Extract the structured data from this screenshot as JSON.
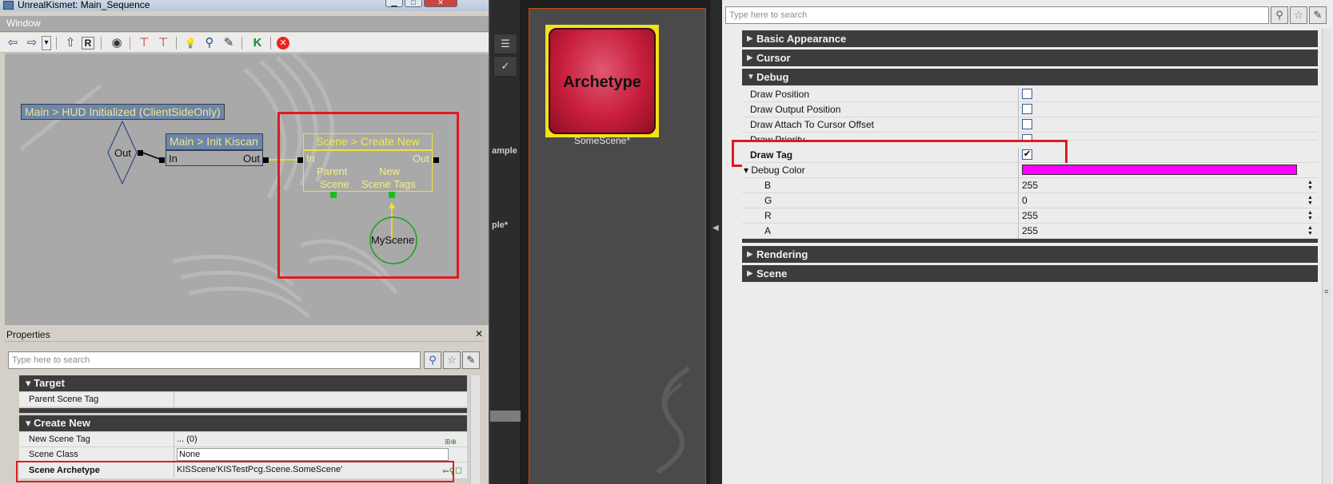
{
  "window": {
    "title": "UnrealKismet: Main_Sequence",
    "menu_label": "Window",
    "minimize": "▁",
    "maximize": "□",
    "close": "✕"
  },
  "toolbar": {
    "icons": [
      "arrow-left-icon",
      "arrow-right-icon",
      "dropdown-icon",
      "arrow-up-icon",
      "refresh-icon",
      "eye-icon",
      "hide-icon",
      "show-icon",
      "bulb-icon",
      "search-icon",
      "wrench-icon",
      "kismet-icon",
      "stop-icon"
    ],
    "glyphs": [
      "⇦",
      "⇨",
      "▾",
      "⇧",
      "R",
      "◉",
      "⊤",
      "⊤",
      "💡",
      "⚲",
      "✎",
      "K",
      "✕"
    ]
  },
  "graph": {
    "event_node": {
      "title": "Main > HUD Initialized (ClientSideOnly)",
      "out_label": "Out"
    },
    "init_node": {
      "title": "Main > Init Kiscan",
      "in_label": "In",
      "out_label": "Out"
    },
    "create_node": {
      "title": "Scene > Create New",
      "in_label": "In",
      "out_label": "Out",
      "var1_label_line1": "Parent",
      "var1_label_line2": "Scene",
      "var2_label_line1": "New",
      "var2_label_line2": "Scene Tags"
    },
    "variable": {
      "label": "MyScene"
    }
  },
  "properties_panel": {
    "title": "Properties",
    "close": "✕",
    "search_placeholder": "Type here to search",
    "categories": [
      {
        "label": "Target",
        "rows": [
          {
            "key": "Parent Scene Tag",
            "value": ""
          }
        ]
      },
      {
        "label": "Create New",
        "rows": [
          {
            "key": "New Scene Tag",
            "value": "... (0)"
          },
          {
            "key": "Scene Class",
            "value": "None"
          },
          {
            "key": "Scene Archetype",
            "value": "KISScene'KISTestPcg.Scene.SomeScene'"
          }
        ]
      }
    ]
  },
  "content_browser": {
    "side_labels": [
      "ample",
      "ple*"
    ],
    "asset": {
      "thumbnail_text": "Archetype",
      "name": "SomeScene*"
    }
  },
  "right_panel": {
    "search_placeholder": "Type here to search",
    "categories": {
      "basic_appearance": "Basic Appearance",
      "cursor": "Cursor",
      "debug": "Debug",
      "rendering": "Rendering",
      "scene": "Scene"
    },
    "debug_rows": [
      {
        "key": "Draw Position",
        "checked": false
      },
      {
        "key": "Draw Output Position",
        "checked": false
      },
      {
        "key": "Draw Attach To Cursor Offset",
        "checked": false
      },
      {
        "key": "Draw Priority",
        "checked": false
      },
      {
        "key": "Draw Tag",
        "checked": true
      }
    ],
    "debug_color": {
      "label": "Debug Color",
      "swatch": "#ff00ff",
      "components": [
        {
          "key": "B",
          "value": "255"
        },
        {
          "key": "G",
          "value": "0"
        },
        {
          "key": "R",
          "value": "255"
        },
        {
          "key": "A",
          "value": "255"
        }
      ]
    }
  },
  "colors": {
    "highlight_red": "#e01a22",
    "node_yellow": "#efe13a",
    "asset_frame": "#f1e21a",
    "debug_swatch": "#ff00ff"
  }
}
